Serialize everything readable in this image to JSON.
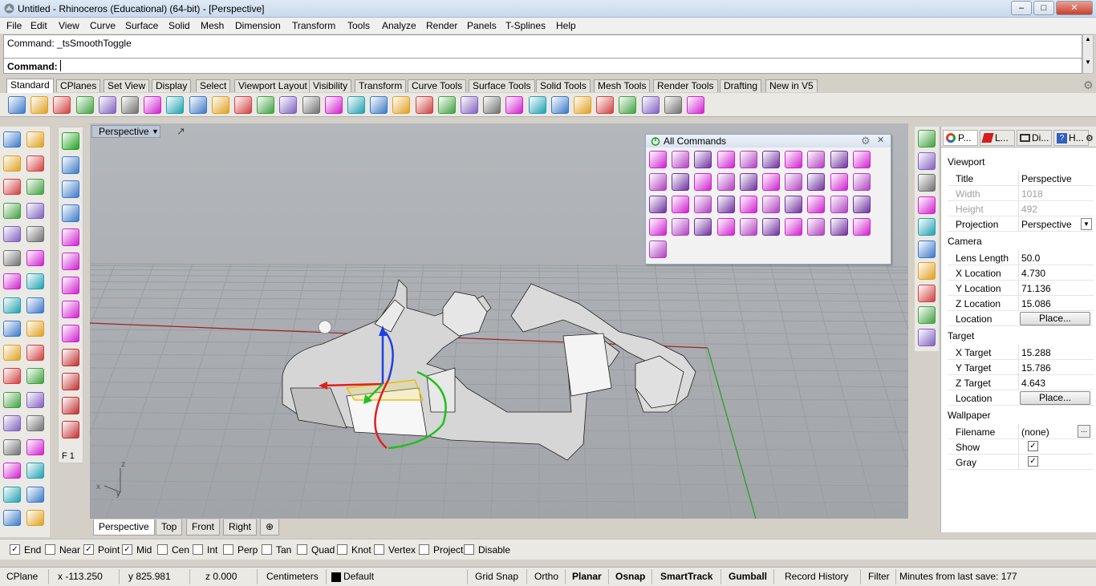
{
  "window": {
    "title": "Untitled - Rhinoceros (Educational) (64-bit) - [Perspective]",
    "minimize": "–",
    "maximize": "□",
    "close": "✕"
  },
  "menu": [
    "File",
    "Edit",
    "View",
    "Curve",
    "Surface",
    "Solid",
    "Mesh",
    "Dimension",
    "Transform",
    "Tools",
    "Analyze",
    "Render",
    "Panels",
    "T-Splines",
    "Help"
  ],
  "command": {
    "history": "Command: _tsSmoothToggle",
    "prompt_label": "Command:",
    "value": ""
  },
  "toolbar_tabs": [
    "Standard",
    "CPlanes",
    "Set View",
    "Display",
    "Select",
    "Viewport Layout",
    "Visibility",
    "Transform",
    "Curve Tools",
    "Surface Tools",
    "Solid Tools",
    "Mesh Tools",
    "Render Tools",
    "Drafting",
    "New in V5"
  ],
  "standard_icons": [
    "new-icon",
    "open-icon",
    "save-icon",
    "print-icon",
    "import-icon",
    "cut-icon",
    "copy-icon",
    "paste-icon",
    "undo-icon",
    "pan-icon",
    "rotate-view-icon",
    "zoom-icon",
    "zoom-window-icon",
    "zoom-extents-icon",
    "zoom-selected-icon",
    "four-viewports-icon",
    "car-icon",
    "options-icon",
    "cplane-icon",
    "point-icon",
    "light-icon",
    "lock-icon",
    "layer-icon",
    "color-wheel-icon",
    "render-sphere-icon",
    "render-preview-icon",
    "material-sphere-icon",
    "snap-tools-icon",
    "gear-tools-icon",
    "selection-tools-icon",
    "help-icon"
  ],
  "viewport": {
    "name": "Perspective",
    "axis_z": "z",
    "axis_x": "x",
    "axis_y": "y"
  },
  "f1_label": "F 1",
  "view_tabs": [
    "Perspective",
    "Top",
    "Front",
    "Right",
    "⊕"
  ],
  "all_commands": {
    "title": "All Commands",
    "count": 41
  },
  "properties": {
    "tabs": [
      "P...",
      "L...",
      "Di...",
      "H..."
    ],
    "viewport_section": "Viewport",
    "title_label": "Title",
    "title_value": "Perspective",
    "width_label": "Width",
    "width_value": "1018",
    "height_label": "Height",
    "height_value": "492",
    "projection_label": "Projection",
    "projection_value": "Perspective",
    "camera_section": "Camera",
    "lens_label": "Lens Length",
    "lens_value": "50.0",
    "xloc_label": "X Location",
    "xloc_value": "4.730",
    "yloc_label": "Y Location",
    "yloc_value": "71.136",
    "zloc_label": "Z Location",
    "zloc_value": "15.086",
    "location_label": "Location",
    "place_button": "Place...",
    "target_section": "Target",
    "xt_label": "X Target",
    "xt_value": "15.288",
    "yt_label": "Y Target",
    "yt_value": "15.786",
    "zt_label": "Z Target",
    "zt_value": "4.643",
    "tlocation_label": "Location",
    "wallpaper_section": "Wallpaper",
    "filename_label": "Filename",
    "filename_value": "(none)",
    "browse_button": "...",
    "show_label": "Show",
    "show_checked": true,
    "gray_label": "Gray",
    "gray_checked": true
  },
  "osnaps": [
    {
      "label": "End",
      "checked": true
    },
    {
      "label": "Near",
      "checked": false
    },
    {
      "label": "Point",
      "checked": true
    },
    {
      "label": "Mid",
      "checked": true
    },
    {
      "label": "Cen",
      "checked": false
    },
    {
      "label": "Int",
      "checked": false
    },
    {
      "label": "Perp",
      "checked": false
    },
    {
      "label": "Tan",
      "checked": false
    },
    {
      "label": "Quad",
      "checked": false
    },
    {
      "label": "Knot",
      "checked": false
    },
    {
      "label": "Vertex",
      "checked": false
    },
    {
      "label": "Project",
      "checked": false
    },
    {
      "label": "Disable",
      "checked": false
    }
  ],
  "status": {
    "cplane": "CPlane",
    "x": "x -113.250",
    "y": "y 825.981",
    "z": "z 0.000",
    "units": "Centimeters",
    "layer": "Default",
    "layer_color": "#000000",
    "grid_snap": "Grid Snap",
    "ortho": "Ortho",
    "planar": "Planar",
    "osnap": "Osnap",
    "smarttrack": "SmartTrack",
    "gumball": "Gumball",
    "record_history": "Record History",
    "filter": "Filter",
    "minutes": "Minutes from last save: 177"
  },
  "colors": {
    "viewport_bg": "#a6a9ad",
    "grid_line": "#9a9da1",
    "x_axis": "#a02020",
    "y_axis": "#20a020",
    "tspline_magenta": "#d020d0",
    "gumball_red": "#e02020",
    "gumball_green": "#20c020",
    "gumball_blue": "#2040e0"
  }
}
